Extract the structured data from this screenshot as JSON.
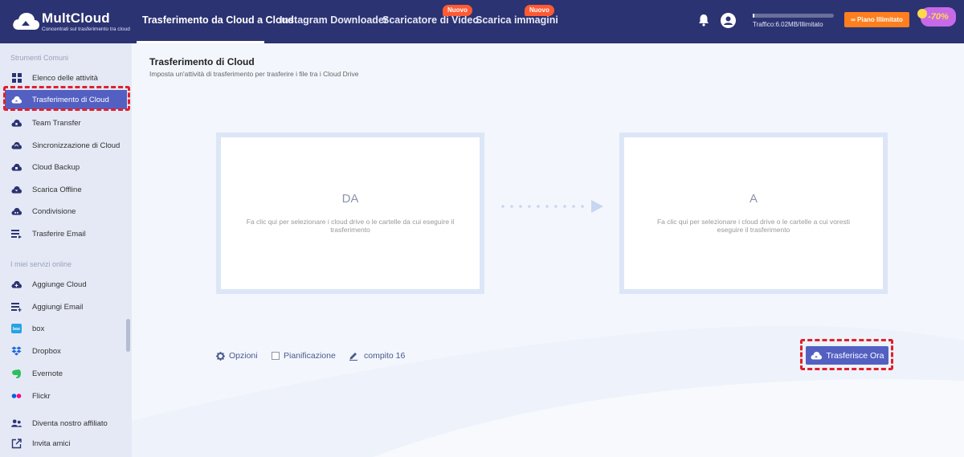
{
  "app": {
    "name": "MultCloud",
    "tagline": "Concentrati sul trasferimento tra cloud"
  },
  "nav": {
    "tabs": [
      {
        "label": "Trasferimento da Cloud a Cloud",
        "active": true
      },
      {
        "label": "Instagram Downloader"
      },
      {
        "label": "Scaricatore di Video",
        "badge": "Nuovo"
      },
      {
        "label": "Scarica immagini",
        "badge": "Nuovo"
      }
    ]
  },
  "header": {
    "traffic_label": "Traffico:6.02MB/Illimitato",
    "traffic_used_fraction": 0.02,
    "plan_button": "Piano Illimitato",
    "promo": "-70%"
  },
  "sidebar": {
    "section1_title": "Strumenti Comuni",
    "section1_items": [
      {
        "label": "Elenco delle attività",
        "icon": "grid-icon"
      },
      {
        "label": "Trasferimento di Cloud",
        "icon": "cloud-transfer-icon",
        "active": true
      },
      {
        "label": "Team Transfer",
        "icon": "team-transfer-icon"
      },
      {
        "label": "Sincronizzazione di Cloud",
        "icon": "cloud-sync-icon"
      },
      {
        "label": "Cloud Backup",
        "icon": "cloud-backup-icon"
      },
      {
        "label": "Scarica Offline",
        "icon": "offline-download-icon"
      },
      {
        "label": "Condivisione",
        "icon": "share-icon"
      },
      {
        "label": "Trasferire Email",
        "icon": "email-transfer-icon"
      }
    ],
    "section2_title": "I miei servizi online",
    "section2_items": [
      {
        "label": "Aggiunge Cloud",
        "icon": "add-cloud-icon"
      },
      {
        "label": "Aggiungi Email",
        "icon": "add-email-icon"
      },
      {
        "label": "box",
        "icon": "box-icon"
      },
      {
        "label": "Dropbox",
        "icon": "dropbox-icon"
      },
      {
        "label": "Evernote",
        "icon": "evernote-icon"
      },
      {
        "label": "Flickr",
        "icon": "flickr-icon"
      }
    ],
    "footer_items": [
      {
        "label": "Diventa nostro affiliato",
        "icon": "affiliate-icon"
      },
      {
        "label": "Invita amici",
        "icon": "invite-icon"
      }
    ]
  },
  "main": {
    "title": "Trasferimento di Cloud",
    "subtitle": "Imposta un'attività di trasferimento per trasferire i file tra i Cloud Drive",
    "from": {
      "label": "DA",
      "hint": "Fa clic qui per selezionare i cloud drive o le cartelle da cui eseguire il trasferimento"
    },
    "to": {
      "label": "A",
      "hint": "Fa clic qui per selezionare i cloud drive o le cartelle a cui voresti eseguire il trasferimento"
    },
    "options_label": "Opzioni",
    "schedule_label": "Pianificazione",
    "task_name": "compito 16",
    "transfer_button": "Trasferisce Ora"
  },
  "colors": {
    "topbar": "#2c3372",
    "accent": "#5360c2",
    "badge": "#ff5a34",
    "plan": "#ff7f1e",
    "highlight": "#e0202a"
  }
}
